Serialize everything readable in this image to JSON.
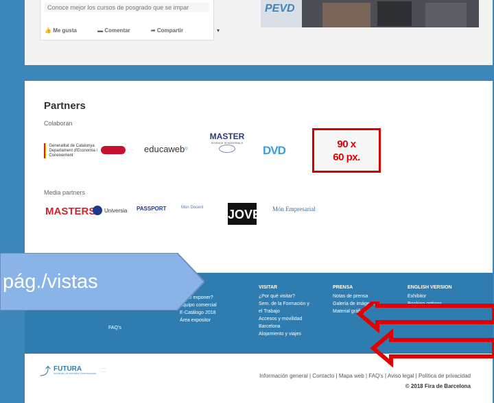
{
  "facebook": {
    "post_text": "Conoce mejor los cursos de posgrado que se impar",
    "actions": [
      "Me gusta",
      "Comentar",
      "Compartir"
    ]
  },
  "partners": {
    "title": "Partners",
    "collaborate_label": "Colaboran",
    "media_label": "Media partners",
    "collaborators": {
      "gencat": "Generalitat de Catalunya Departament d'Economia i Coneixement",
      "educaweb": "educaweb",
      "master": "MASTER",
      "master_sub": "SCIENCE IN MATERIALS",
      "dvd": "DVD"
    },
    "placeholder_line1": "90 x",
    "placeholder_line2": "60 px.",
    "media": {
      "masters": "MASTERS",
      "universia": "Universia",
      "passport": "PASSPORT",
      "mon_docent": "Món Docent",
      "jove": "JOVE",
      "mon_empresarial": "Món Empresarial"
    }
  },
  "footer": {
    "col_exhibitor": [
      "¿Qué exponer?",
      "Equipo comercial",
      "E-Catálogo 2018",
      "Área expositor"
    ],
    "col_faq": "FAQ's",
    "col_visit_title": "VISITAR",
    "col_visit": [
      "¿Por qué visitar?",
      "Sem. de la Formación y",
      "el Trabajo",
      "Accesos y movilidad",
      "Barcelona",
      "Alojamiento y viajes"
    ],
    "col_press_title": "PRENSA",
    "col_press": [
      "Notas de prensa",
      "Galería de imágenes",
      "Material gráfico"
    ],
    "col_english_title": "ENGLISH VERSION",
    "col_english": [
      "Exhibitor",
      "Booking options"
    ]
  },
  "bottom": {
    "brand": "FUTURA",
    "brand_sub": "SALÓN DE LOS MASTERS Y POSTGRADOS",
    "links": "Información general | Contacto | Mapa web | FAQ's | Aviso legal | Política de privacidad",
    "copyright": "© 2018 Fira de Barcelona"
  },
  "callout": {
    "label": "pág./vistas",
    "fill": "#8ab4e8",
    "stroke": "#6a8fc0"
  },
  "arrows": {
    "color": "#e30000"
  }
}
